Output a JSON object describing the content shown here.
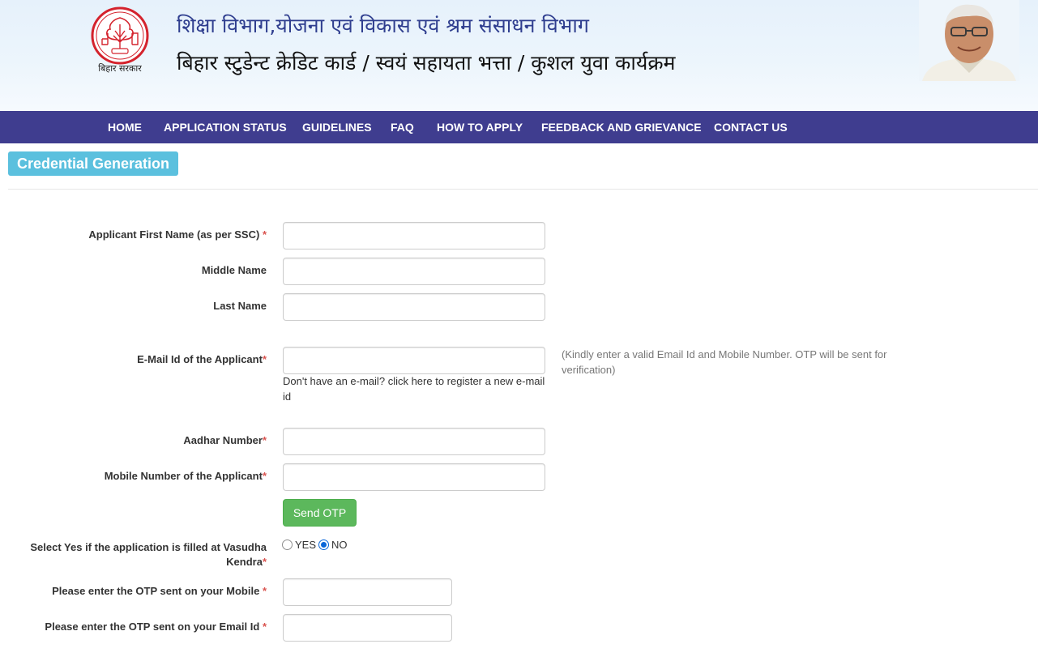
{
  "header": {
    "emblem_caption": "बिहार सरकार",
    "department_title": "शिक्षा विभाग,योजना एवं विकास एवं श्रम संसाधन विभाग",
    "scheme_title": "बिहार स्टुडेन्ट क्रेडिट कार्ड / स्वयं सहायता भत्ता / कुशल युवा कार्यक्रम"
  },
  "nav": {
    "items": [
      {
        "label": "HOME"
      },
      {
        "label": "APPLICATION STATUS"
      },
      {
        "label": "GUIDELINES"
      },
      {
        "label": "FAQ"
      },
      {
        "label": "HOW TO APPLY"
      },
      {
        "label": "FEEDBACK AND GRIEVANCE"
      },
      {
        "label": "CONTACT US"
      }
    ]
  },
  "page": {
    "title": "Credential Generation"
  },
  "form": {
    "first_name": {
      "label": "Applicant First Name (as per SSC)",
      "required": "*",
      "value": "",
      "placeholder": ""
    },
    "middle_name": {
      "label": "Middle Name",
      "value": "",
      "placeholder": ""
    },
    "last_name": {
      "label": "Last Name",
      "value": "",
      "placeholder": ""
    },
    "email": {
      "label": "E-Mail Id of the Applicant",
      "required": "*",
      "value": "",
      "placeholder": ""
    },
    "email_note_prefix": "Don't have an e-mail?",
    "email_register_link": "click here to register a new e-mail id",
    "help_text": "(Kindly enter a valid Email Id and Mobile Number. OTP will be sent for verification)",
    "aadhar": {
      "label": "Aadhar Number",
      "required": "*",
      "value": "",
      "placeholder": ""
    },
    "mobile": {
      "label": "Mobile Number of the Applicant",
      "required": "*",
      "value": "",
      "placeholder": ""
    },
    "send_otp_label": "Send OTP",
    "vasudha": {
      "label_line1": "Select Yes if the application is filled at Vasudha",
      "label_line2": "Kendra",
      "required": "*",
      "options": [
        {
          "label": "YES",
          "checked": false
        },
        {
          "label": "NO",
          "checked": true
        }
      ]
    },
    "otp_mobile": {
      "label": "Please enter the OTP sent on your Mobile",
      "required": "*",
      "value": ""
    },
    "otp_email": {
      "label": "Please enter the OTP sent on your Email Id",
      "required": "*",
      "value": ""
    }
  },
  "colors": {
    "nav_bg": "#3f3d8f",
    "badge_bg": "#5bc0de",
    "button_green": "#5cb85c",
    "required_red": "#d9534f",
    "radio_checked": "#0a66d8"
  }
}
